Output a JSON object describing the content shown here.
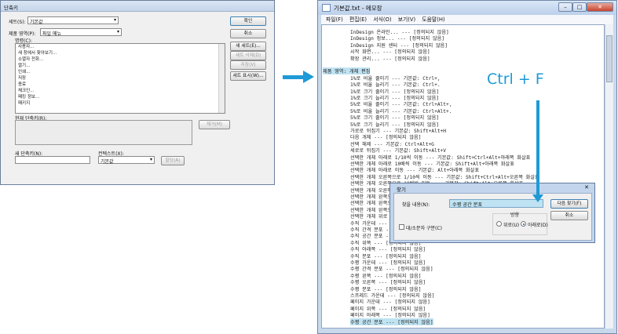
{
  "left_dialog": {
    "title": "단축키",
    "set_label": "세트(S):",
    "set_value": "기본값",
    "area_label": "제품 영역(P):",
    "area_value": "파일 메뉴",
    "commands_label": "명령(C):",
    "commands": [
      "사용자...",
      "새 창에서 찾아보기...",
      "소멸자 전화...",
      "열기...",
      "인쇄...",
      "저장",
      "종료",
      "체크인...",
      "패킹 정보...",
      "패키지"
    ],
    "current_keys_label": "현재 단축키(R):",
    "new_key_label": "새 단축키(N):",
    "context_label": "컨텍스트(X):",
    "context_value": "기본값",
    "buttons": {
      "ok": "확인",
      "cancel": "취소",
      "new_set": "새 세트(E)...",
      "delete_set": "세트 삭제(D)",
      "save": "저장(V)",
      "show_set": "세트 표시(W)...",
      "remove": "제거(M)",
      "assign": "할당(A)"
    }
  },
  "annotation": {
    "shortcut_text": "Ctrl + F",
    "accent_color": "#1e9ad6"
  },
  "notepad": {
    "title": "기본값.txt - 메모장",
    "window_buttons": [
      "–",
      "□",
      "✕"
    ],
    "menu": [
      "파일(F)",
      "편집(E)",
      "서식(O)",
      "보기(V)",
      "도움말(H)"
    ],
    "lines": [
      "InDesign 온라인... --- [정의되지 않음]",
      "InDesign 정보... --- [정의되지 않음]",
      "InDesign 지원 센터 --- [정의되지 않음]",
      "시작 화면... --- [정의되지 않음]",
      "확장 관리... --- [정의되지 않음]",
      "",
      "제품 영역: 개체 편집",
      "1%로 비율 줄이기 --- 기본값: Ctrl+,",
      "1%로 비율 늘리기 --- 기본값: Ctrl+.",
      "1%로 크기 줄이기 --- [정의되지 않음]",
      "1%로 크기 늘리기 --- [정의되지 않음]",
      "5%로 비율 줄이기 --- 기본값: Ctrl+Alt+,",
      "5%로 비율 늘리기 --- 기본값: Ctrl+Alt+.",
      "5%로 크기 줄이기 --- [정의되지 않음]",
      "5%로 크기 늘리기 --- [정의되지 않음]",
      "가로로 뒤집기 --- 기본값: Shift+Alt+H",
      "다음 개체 --- [정의되지 않음]",
      "선택 해제 --- 기본값: Ctrl+Alt+G",
      "세로로 뒤집기 --- 기본값: Shift+Alt+V",
      "선택한 개체 아래로 1/10씩 이동 --- 기본값: Shift+Ctrl+Alt+아래쪽 화살표",
      "선택한 개체 아래로 10배씩 이동 --- 기본값: Shift+Alt+아래쪽 화살표",
      "선택한 개체 아래로 이동 --- 기본값: Alt+아래쪽 화살표",
      "선택한 개체 오른쪽으로 1/10씩 이동 --- 기본값: Shift+Ctrl+Alt+오른쪽 화살표",
      "선택한 개체 오른쪽으로 10배씩 이동 --- 기본값: Shift+Alt+오른쪽 화살표",
      "선택한 개체 오른쪽으로 이동 --- 기본값: Alt+오른쪽 화살표",
      "선택한 개체 왼쪽으로 1/10씩 이동 --- 기본값: Shift+Ctrl+Alt+왼쪽 화살표",
      "선택한 개체 왼쪽으로 10배씩 이동 --- 기본값: Shift+Alt+왼쪽 화살표",
      "선택한 개체 왼쪽으로 이동 --- 기본값: Alt+왼쪽 화살표",
      "선택한 개체 위로 --- [정의되지 않음]",
      "수직 가운데 --- [정의되지 않음]",
      "수직 간격 분포 --- [정의되지 않음]",
      "수직 공간 분포 --- [정의되지 않음]",
      "수직 위쪽 --- [정의되지 않음]",
      "수직 아래쪽 --- [정의되지 않음]",
      "수직 분포 --- [정의되지 않음]",
      "수평 가운데 --- [정의되지 않음]",
      "수평 간격 분포 --- [정의되지 않음]",
      "수평 왼쪽 --- [정의되지 않음]",
      "수평 오른쪽 --- [정의되지 않음]",
      "수평 분포 --- [정의되지 않음]",
      "스프레드 가운데 --- [정의되지 않음]",
      "페이지 가운데 --- [정의되지 않음]",
      "페이지 위쪽 --- [정의되지 않음]",
      "페이지 아래쪽 --- [정의되지 않음]",
      "수평 공간 분포 --- [정의되지 않음]"
    ]
  },
  "find_dialog": {
    "title": "찾기",
    "close": "✕",
    "find_label": "찾을 내용(N):",
    "find_value": "수평 공간 분포",
    "direction_label": "방향",
    "up_label": "위로(U)",
    "down_label": "아래로(D)",
    "case_label": "대/소문자 구분(C)",
    "find_next": "다음 찾기(F)",
    "cancel": "취소"
  }
}
